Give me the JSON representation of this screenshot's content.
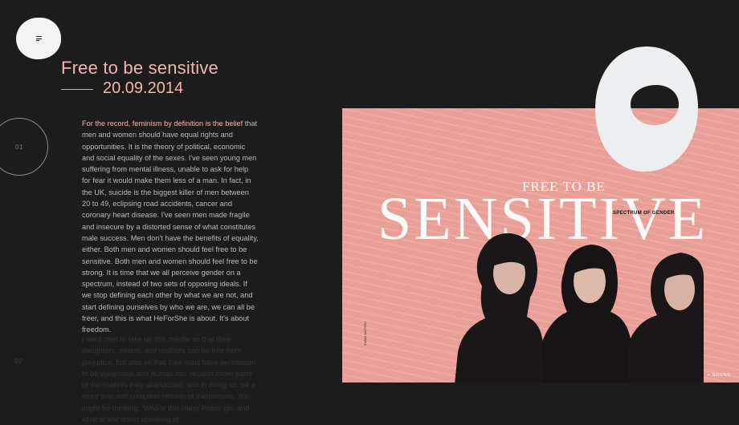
{
  "nav": {
    "menu_icon": "menu-icon"
  },
  "article": {
    "title": "Free to be sensitive",
    "date": "20.09.2014"
  },
  "chapters": [
    {
      "number": "01"
    },
    {
      "number": "02"
    }
  ],
  "paragraphs": [
    {
      "highlight": "For the record, feminism by definition is the belief",
      "text": " that men and women should have equal rights and opportunities. It is the theory of political, economic and social equality of the sexes. I've seen young men suffering from mental illness, unable to ask for help for fear it would make them less of a man. In fact, in the UK, suicide is the biggest killer of men between 20 to 49, eclipsing road accidents, cancer and coronary heart disease. I've seen men made fragile and insecure by a distorted sense of what constitutes male success. Men don't have the benefits of equality, either. Both men and women should feel free to be sensitive. Both men and women should feel free to be strong. It is time that we all perceive gender on a spectrum, instead of two sets of opposing ideals. If we stop defining each other by what we are not, and start defining ourselves by who we are, we can all be freer, and this is what HeForShe is about. It's about freedom."
    },
    {
      "text": "I want men to take up this mantle so that their daughters, sisters, and mothers can be free from prejudice, but also so that their sons have permission to be vulnerable and human too, reclaim those parts of themselves they abandoned, and in doing so, be a more true and complete version of themselves. You might be thinking, 'Who is this Harry Potter girl, and what is she doing speaking at"
    }
  ],
  "poster": {
    "subtitle": "FREE TO BE",
    "headline": "SENSITIVE",
    "tag": "SPECTRUM OF GENDER",
    "side_text": "EMMA WATSON",
    "corner_text": "+ SOUND"
  },
  "colors": {
    "background": "#1d1c1d",
    "accent": "#f2b5ac",
    "poster_pink": "#eea49c"
  }
}
